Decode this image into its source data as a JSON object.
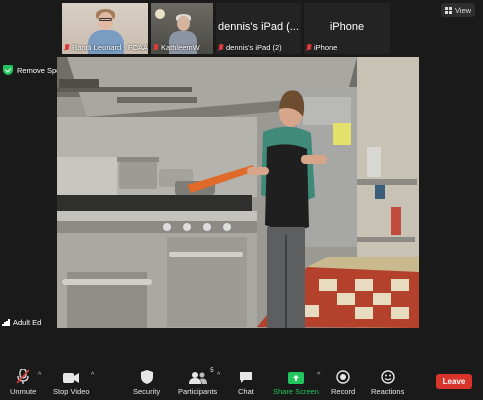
{
  "thumbnails": [
    {
      "name": "Randi Leonard - FCAAE",
      "type": "video"
    },
    {
      "name": "KathleemW",
      "type": "video"
    },
    {
      "name": "dennis's iPad (2)",
      "title": "dennis's iPad (...",
      "type": "name"
    },
    {
      "name": "iPhone",
      "title": "iPhone",
      "type": "name"
    }
  ],
  "view_button": {
    "label": "View",
    "icon": "grid-icon"
  },
  "spotlight": {
    "label": "Remove Spotlight",
    "icon": "shield-icon"
  },
  "main_video": {
    "participant_label": "Adult Ed"
  },
  "toolbar": {
    "unmute": "Unmute",
    "stop_video": "Stop Video",
    "security": "Security",
    "participants": "Participants",
    "participant_count": "5",
    "chat": "Chat",
    "share_screen": "Share Screen",
    "record": "Record",
    "reactions": "Reactions",
    "leave": "Leave"
  },
  "colors": {
    "accent_green": "#23c55e",
    "leave_red": "#d9342b",
    "muted_red": "#e03a3a"
  }
}
